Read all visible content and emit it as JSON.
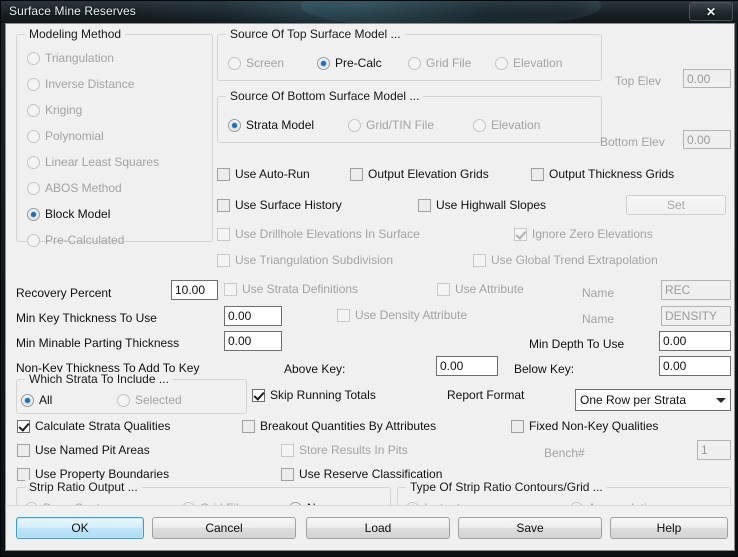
{
  "window": {
    "title": "Surface Mine Reserves",
    "close_label": "✕"
  },
  "modeling_method": {
    "group_title": "Modeling Method",
    "options": [
      {
        "label": "Triangulation",
        "selected": false,
        "disabled": true
      },
      {
        "label": "Inverse Distance",
        "selected": false,
        "disabled": true
      },
      {
        "label": "Kriging",
        "selected": false,
        "disabled": true
      },
      {
        "label": "Polynomial",
        "selected": false,
        "disabled": true
      },
      {
        "label": "Linear Least Squares",
        "selected": false,
        "disabled": true
      },
      {
        "label": "ABOS Method",
        "selected": false,
        "disabled": true
      },
      {
        "label": "Block Model",
        "selected": true,
        "disabled": false
      },
      {
        "label": "Pre-Calculated",
        "selected": false,
        "disabled": true
      }
    ]
  },
  "top_surface": {
    "group_title": "Source Of Top Surface Model ...",
    "options": [
      {
        "label": "Screen",
        "selected": false,
        "disabled": true
      },
      {
        "label": "Pre-Calc",
        "selected": true,
        "disabled": false
      },
      {
        "label": "Grid File",
        "selected": false,
        "disabled": true
      },
      {
        "label": "Elevation",
        "selected": false,
        "disabled": true
      }
    ],
    "elev_label": "Top Elev",
    "elev_value": "0.00"
  },
  "bottom_surface": {
    "group_title": "Source Of Bottom Surface Model ...",
    "options": [
      {
        "label": "Strata Model",
        "selected": true,
        "disabled": false
      },
      {
        "label": "Grid/TIN File",
        "selected": false,
        "disabled": true
      },
      {
        "label": "Elevation",
        "selected": false,
        "disabled": true
      }
    ],
    "elev_label": "Bottom Elev",
    "elev_value": "0.00"
  },
  "options_checkboxes": {
    "use_auto_run": {
      "label": "Use Auto-Run",
      "checked": false,
      "disabled": false
    },
    "output_elevation_grids": {
      "label": "Output Elevation Grids",
      "checked": false,
      "disabled": false
    },
    "output_thickness_grids": {
      "label": "Output Thickness Grids",
      "checked": false,
      "disabled": false
    },
    "use_surface_history": {
      "label": "Use Surface History",
      "checked": false,
      "disabled": false
    },
    "use_highwall_slopes": {
      "label": "Use Highwall Slopes",
      "checked": false,
      "disabled": false
    },
    "set_button": {
      "label": "Set",
      "disabled": true
    },
    "use_drillhole_elevations": {
      "label": "Use Drillhole Elevations In Surface",
      "checked": false,
      "disabled": true
    },
    "ignore_zero_elevations": {
      "label": "Ignore Zero Elevations",
      "checked": true,
      "disabled": true
    },
    "use_triangulation_subdivision": {
      "label": "Use Triangulation Subdivision",
      "checked": false,
      "disabled": true
    },
    "use_global_trend_extrapolation": {
      "label": "Use Global Trend Extrapolation",
      "checked": false,
      "disabled": true
    }
  },
  "parameters": {
    "recovery_percent_label": "Recovery Percent",
    "recovery_percent_value": "10.00",
    "use_strata_definitions": {
      "label": "Use Strata Definitions",
      "checked": false,
      "disabled": true
    },
    "use_attribute": {
      "label": "Use Attribute",
      "checked": false,
      "disabled": true
    },
    "attr_name_label": "Name",
    "attr_name_value": "REC",
    "min_key_thickness_label": "Min Key Thickness To Use",
    "min_key_thickness_value": "0.00",
    "use_density_attribute": {
      "label": "Use Density Attribute",
      "checked": false,
      "disabled": true
    },
    "density_name_label": "Name",
    "density_name_value": "DENSITY",
    "min_minable_parting_label": "Min Minable Parting Thickness",
    "min_minable_parting_value": "0.00",
    "min_depth_label": "Min Depth To Use",
    "min_depth_value": "0.00",
    "non_key_thickness_label": "Non-Key Thickness To Add To Key",
    "above_key_label": "Above Key:",
    "above_key_value": "0.00",
    "below_key_label": "Below Key:",
    "below_key_value": "0.00",
    "skip_running_totals": {
      "label": "Skip Running Totals",
      "checked": true,
      "disabled": false
    },
    "report_format_label": "Report Format",
    "report_format_value": "One Row per Strata",
    "report_format_options": [
      "One Row per Strata"
    ]
  },
  "which_strata": {
    "group_title": "Which Strata To Include ...",
    "options": [
      {
        "label": "All",
        "selected": true,
        "disabled": false
      },
      {
        "label": "Selected",
        "selected": false,
        "disabled": true
      }
    ]
  },
  "bottom_checkboxes": {
    "calculate_strata_qualities": {
      "label": "Calculate Strata Qualities",
      "checked": true,
      "disabled": false
    },
    "breakout_quantities": {
      "label": "Breakout Quantities By Attributes",
      "checked": false,
      "disabled": false
    },
    "fixed_non_key_qualities": {
      "label": "Fixed Non-Key Qualities",
      "checked": false,
      "disabled": false
    },
    "use_named_pit_areas": {
      "label": "Use Named Pit Areas",
      "checked": false,
      "disabled": false
    },
    "store_results_in_pits": {
      "label": "Store Results In Pits",
      "checked": false,
      "disabled": true
    },
    "bench_label": "Bench#",
    "bench_value": "1",
    "use_property_boundaries": {
      "label": "Use Property Boundaries",
      "checked": false,
      "disabled": false
    },
    "use_reserve_classification": {
      "label": "Use Reserve Classification",
      "checked": false,
      "disabled": false
    }
  },
  "strip_ratio_output": {
    "group_title": "Strip Ratio Output ...",
    "options": [
      {
        "label": "Draw Contours",
        "selected": false,
        "disabled": true
      },
      {
        "label": "Grid File",
        "selected": false,
        "disabled": true
      },
      {
        "label": "None",
        "selected": true,
        "disabled": false
      }
    ]
  },
  "strip_ratio_type": {
    "group_title": "Type Of Strip Ratio Contours/Grid ...",
    "options": [
      {
        "label": "Instantaneous",
        "selected": true,
        "disabled": true
      },
      {
        "label": "Accumulative",
        "selected": false,
        "disabled": true
      }
    ]
  },
  "footer_buttons": [
    {
      "label": "OK",
      "default": true
    },
    {
      "label": "Cancel",
      "default": false
    },
    {
      "label": "Load",
      "default": false
    },
    {
      "label": "Save",
      "default": false
    },
    {
      "label": "Help",
      "default": false
    }
  ],
  "colors": {
    "accent": "#1a6fb5",
    "default_button_border": "#3c9fd4",
    "client_bg": "#f0f0f0",
    "disabled_text": "#a3a3a3"
  }
}
